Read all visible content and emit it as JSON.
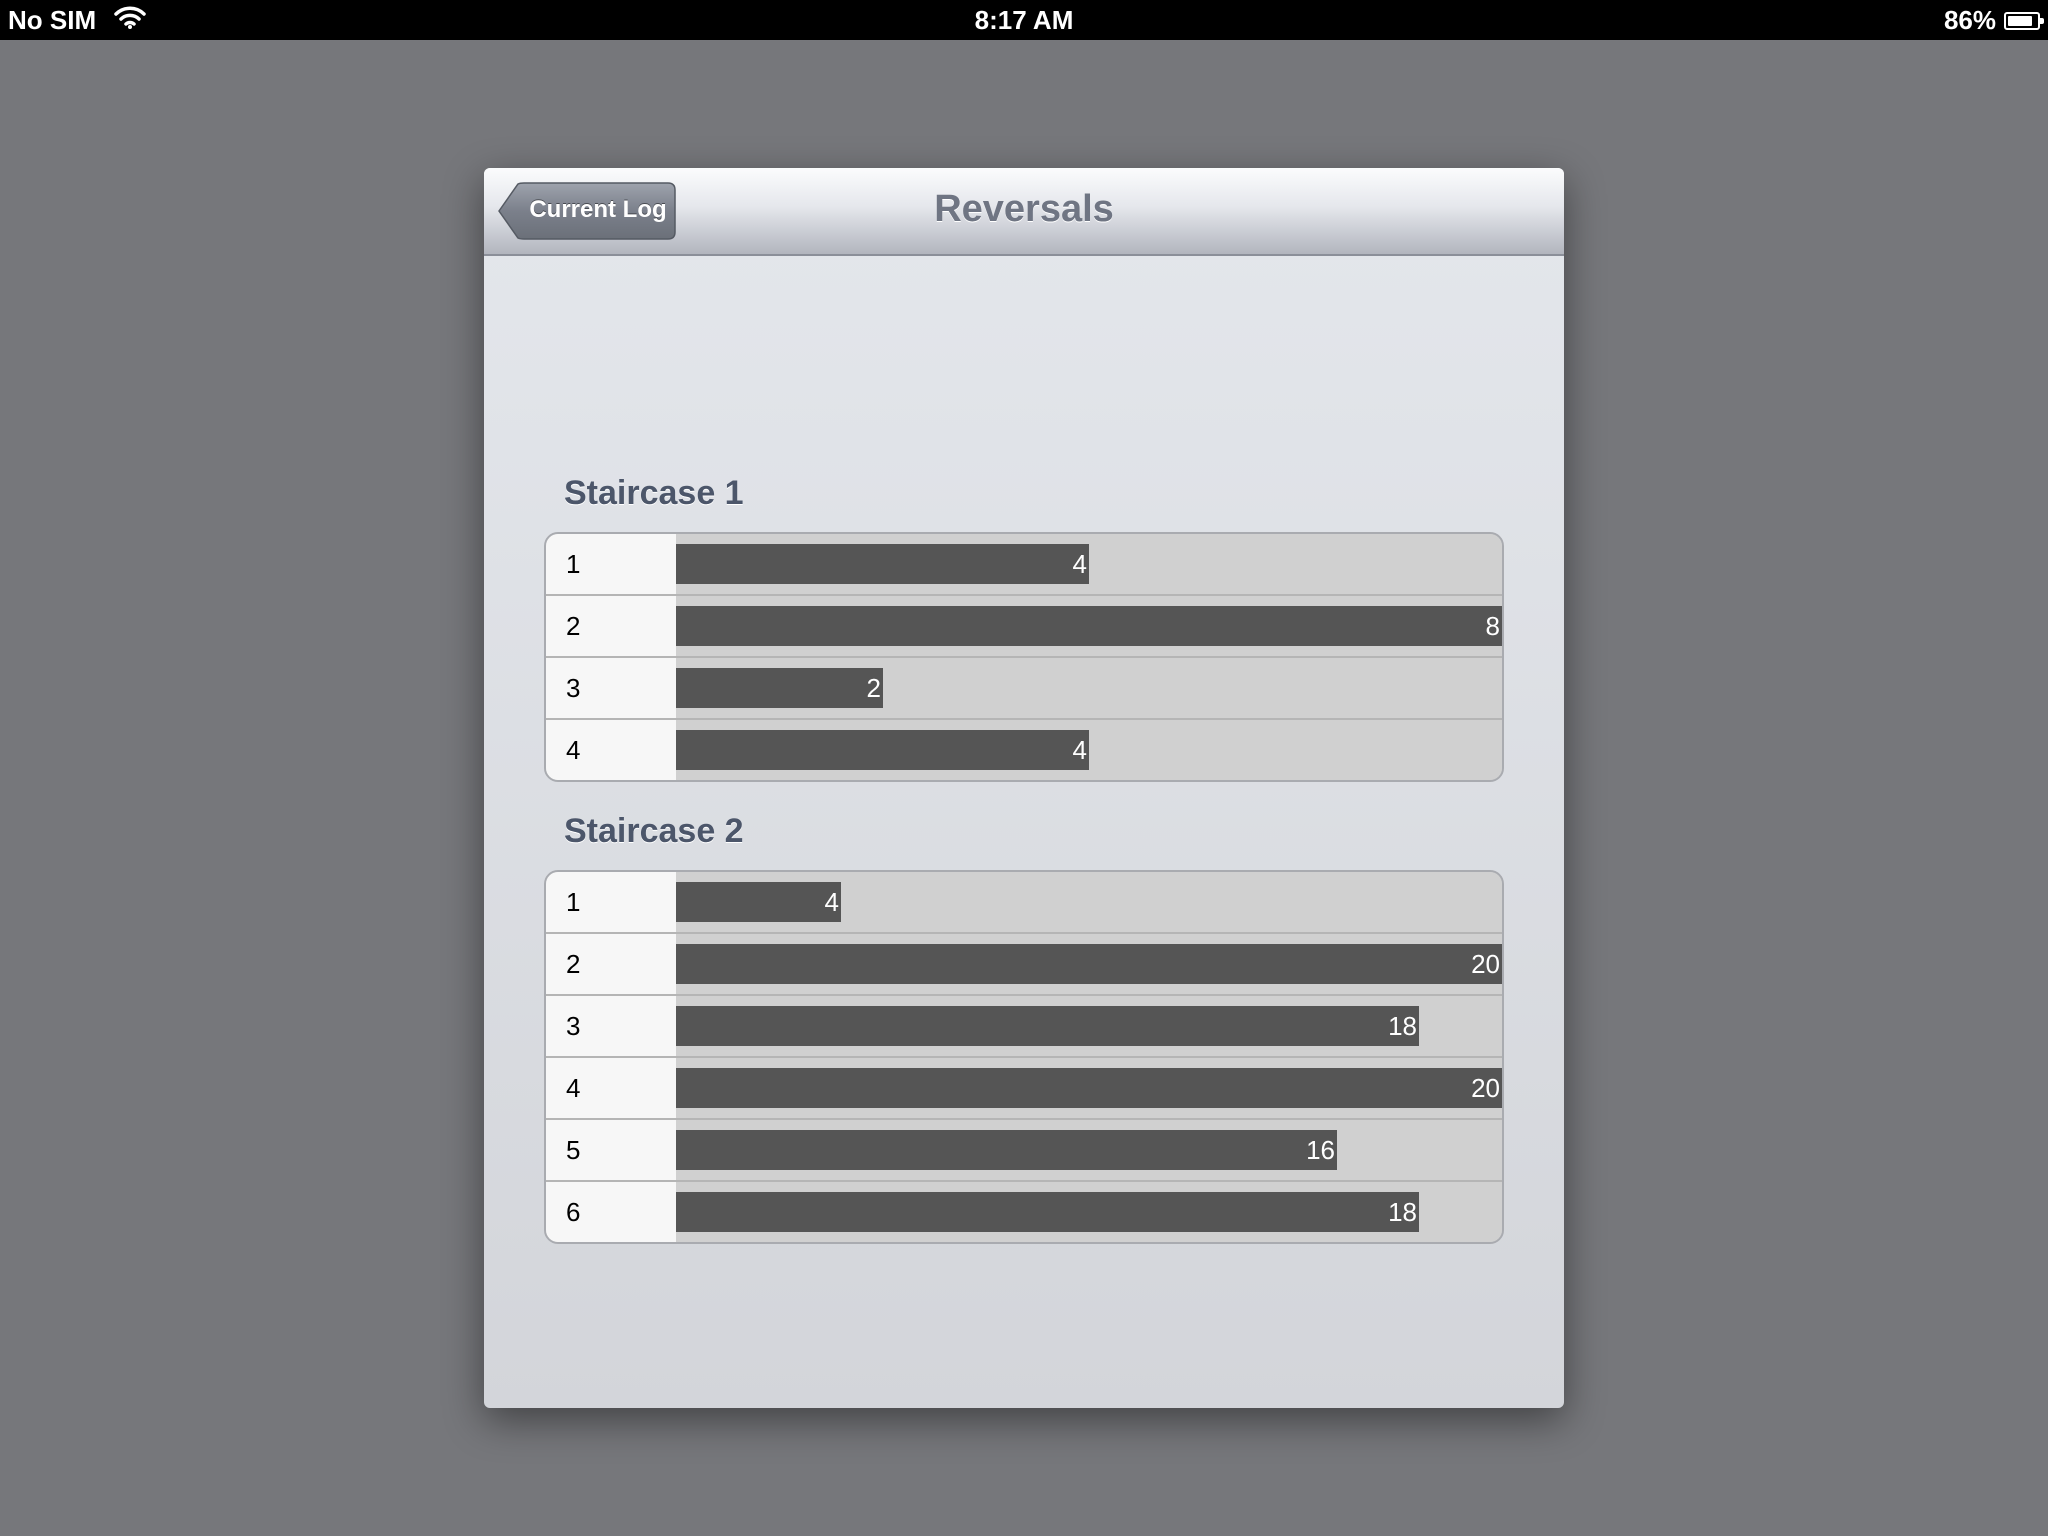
{
  "status_bar": {
    "carrier": "No SIM",
    "time": "8:17 AM",
    "battery": "86%",
    "battery_level": 0.86
  },
  "navbar": {
    "title": "Reversals",
    "back_label": "Current Log"
  },
  "staircases": [
    {
      "title": "Staircase 1",
      "max": 8,
      "rows": [
        {
          "label": "1",
          "value": 4
        },
        {
          "label": "2",
          "value": 8
        },
        {
          "label": "3",
          "value": 2
        },
        {
          "label": "4",
          "value": 4
        }
      ]
    },
    {
      "title": "Staircase 2",
      "max": 20,
      "rows": [
        {
          "label": "1",
          "value": 4
        },
        {
          "label": "2",
          "value": 20
        },
        {
          "label": "3",
          "value": 18
        },
        {
          "label": "4",
          "value": 20
        },
        {
          "label": "5",
          "value": 16
        },
        {
          "label": "6",
          "value": 18
        }
      ]
    }
  ],
  "icons": {
    "signal": "wifi-icon",
    "battery": "battery-icon",
    "back": "back-chevron"
  }
}
